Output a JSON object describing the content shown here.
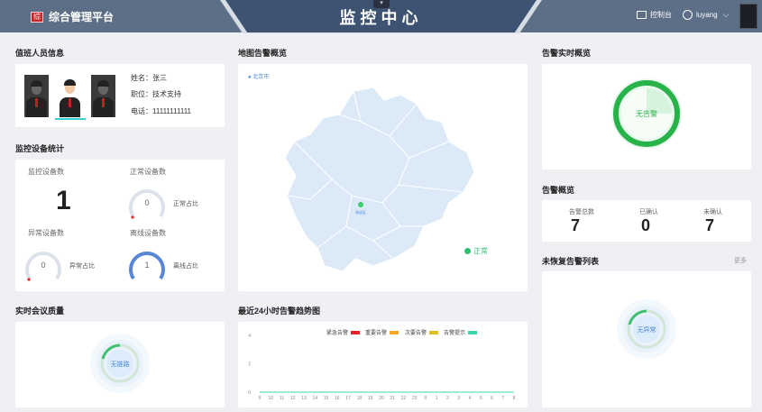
{
  "header": {
    "brand_logo_text": "综",
    "brand_name": "综合管理平台",
    "title": "监控中心",
    "collapse_icon": "chevron-down-icon",
    "console_label": "控制台",
    "username": "luyang"
  },
  "staff": {
    "title": "值班人员信息",
    "name": "姓名：张三",
    "position": "职位：技术支持",
    "phone": "电话：11111111111"
  },
  "devices": {
    "title": "监控设备统计",
    "total_label": "监控设备数",
    "total_value": "1",
    "normal_label": "正常设备数",
    "normal_value": "0",
    "normal_ratio_label": "正常占比",
    "abnormal_label": "异常设备数",
    "abnormal_value": "0",
    "abnormal_ratio_label": "异常占比",
    "offline_label": "离线设备数",
    "offline_value": "1",
    "offline_ratio_label": "离线占比"
  },
  "map": {
    "title": "地图告警概览",
    "region_label": "北京市",
    "marker_label": "海淀区",
    "status_label": "正常"
  },
  "alarm_realtime": {
    "title": "告警实时概览",
    "status": "无告警"
  },
  "alarm_overview": {
    "title": "告警概览",
    "total_label": "告警总数",
    "total_value": "7",
    "confirmed_label": "已确认",
    "confirmed_value": "0",
    "unconfirmed_label": "未确认",
    "unconfirmed_value": "7"
  },
  "unrecovered": {
    "title": "未恢复告警列表",
    "more": "更多",
    "status": "无异常"
  },
  "meeting": {
    "title": "实时会议质量",
    "status": "无链路"
  },
  "trend": {
    "title": "最近24小时告警趋势图",
    "legend": [
      {
        "name": "紧急告警",
        "color": "#e8242b"
      },
      {
        "name": "重要告警",
        "color": "#f5a623"
      },
      {
        "name": "次要告警",
        "color": "#e0c020"
      },
      {
        "name": "告警提示",
        "color": "#3dd6a8"
      }
    ]
  },
  "chart_data": {
    "type": "line",
    "categories": [
      "9",
      "10",
      "11",
      "12",
      "13",
      "14",
      "15",
      "16",
      "17",
      "18",
      "19",
      "20",
      "21",
      "22",
      "23",
      "0",
      "1",
      "2",
      "3",
      "4",
      "5",
      "6",
      "7",
      "8"
    ],
    "series": [
      {
        "name": "紧急告警",
        "values": [
          0,
          0,
          0,
          0,
          0,
          0,
          0,
          0,
          0,
          0,
          0,
          0,
          0,
          0,
          0,
          0,
          0,
          0,
          0,
          0,
          0,
          0,
          0,
          0
        ]
      },
      {
        "name": "重要告警",
        "values": [
          0,
          0,
          0,
          0,
          0,
          0,
          0,
          0,
          0,
          0,
          0,
          0,
          0,
          0,
          0,
          0,
          0,
          0,
          0,
          0,
          0,
          0,
          0,
          0
        ]
      },
      {
        "name": "次要告警",
        "values": [
          0,
          0,
          0,
          0,
          0,
          0,
          0,
          0,
          0,
          0,
          0,
          0,
          0,
          0,
          0,
          0,
          0,
          0,
          0,
          0,
          0,
          0,
          0,
          0
        ]
      },
      {
        "name": "告警提示",
        "values": [
          0,
          0,
          0,
          0,
          0,
          0,
          0,
          0,
          0,
          0,
          0,
          0,
          0,
          0,
          0,
          0,
          0,
          0,
          0,
          0,
          0,
          0,
          0,
          0
        ]
      }
    ],
    "yticks": [
      "0",
      "2",
      "4"
    ],
    "ylim": [
      0,
      4
    ],
    "legend_position": "top-right"
  }
}
